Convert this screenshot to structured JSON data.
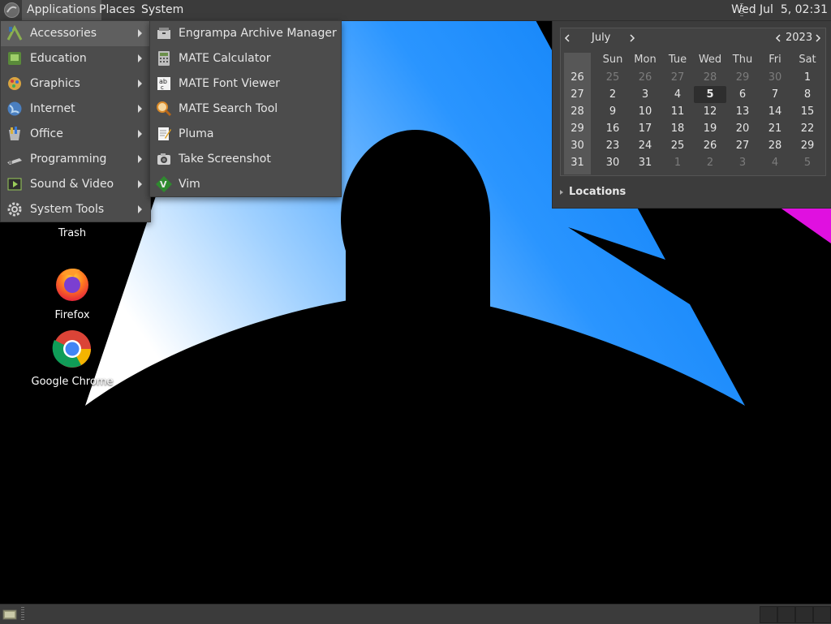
{
  "top_panel": {
    "menus": [
      "Applications",
      "Places",
      "System"
    ],
    "clock": "Wed Jul  5, 02:31"
  },
  "desktop": {
    "icons": [
      {
        "label": "Trash",
        "icon": "trash-icon"
      },
      {
        "label": "Firefox",
        "icon": "firefox-icon"
      },
      {
        "label": "Google Chrome",
        "icon": "chrome-icon"
      }
    ]
  },
  "apps_menu": {
    "items": [
      {
        "label": "Accessories",
        "icon": "accessories-icon",
        "active": true
      },
      {
        "label": "Education",
        "icon": "education-icon"
      },
      {
        "label": "Graphics",
        "icon": "graphics-icon"
      },
      {
        "label": "Internet",
        "icon": "internet-icon"
      },
      {
        "label": "Office",
        "icon": "office-icon"
      },
      {
        "label": "Programming",
        "icon": "programming-icon"
      },
      {
        "label": "Sound & Video",
        "icon": "sound-video-icon"
      },
      {
        "label": "System Tools",
        "icon": "system-tools-icon"
      }
    ]
  },
  "accessories_menu": {
    "items": [
      {
        "label": "Engrampa Archive Manager",
        "icon": "archive-manager-icon"
      },
      {
        "label": "MATE Calculator",
        "icon": "calculator-icon"
      },
      {
        "label": "MATE Font Viewer",
        "icon": "font-viewer-icon"
      },
      {
        "label": "MATE Search Tool",
        "icon": "search-tool-icon"
      },
      {
        "label": "Pluma",
        "icon": "text-editor-icon"
      },
      {
        "label": "Take Screenshot",
        "icon": "screenshot-icon"
      },
      {
        "label": "Vim",
        "icon": "vim-icon"
      }
    ]
  },
  "calendar": {
    "month": "July",
    "year": "2023",
    "weekday_headers": [
      "Sun",
      "Mon",
      "Tue",
      "Wed",
      "Thu",
      "Fri",
      "Sat"
    ],
    "weeks": [
      {
        "number": "26",
        "days": [
          "25",
          "26",
          "27",
          "28",
          "29",
          "30",
          "1"
        ]
      },
      {
        "number": "27",
        "days": [
          "2",
          "3",
          "4",
          "5",
          "6",
          "7",
          "8"
        ]
      },
      {
        "number": "28",
        "days": [
          "9",
          "10",
          "11",
          "12",
          "13",
          "14",
          "15"
        ]
      },
      {
        "number": "29",
        "days": [
          "16",
          "17",
          "18",
          "19",
          "20",
          "21",
          "22"
        ]
      },
      {
        "number": "30",
        "days": [
          "23",
          "24",
          "25",
          "26",
          "27",
          "28",
          "29"
        ]
      },
      {
        "number": "31",
        "days": [
          "30",
          "31",
          "1",
          "2",
          "3",
          "4",
          "5"
        ]
      }
    ],
    "today": "5",
    "locations_label": "Locations"
  },
  "colors": {
    "panel_bg": "#3b3b3b",
    "menu_bg": "#4c4c4c",
    "wallpaper_blue": "#1e90ff",
    "wallpaper_magenta": "#e010e0"
  }
}
